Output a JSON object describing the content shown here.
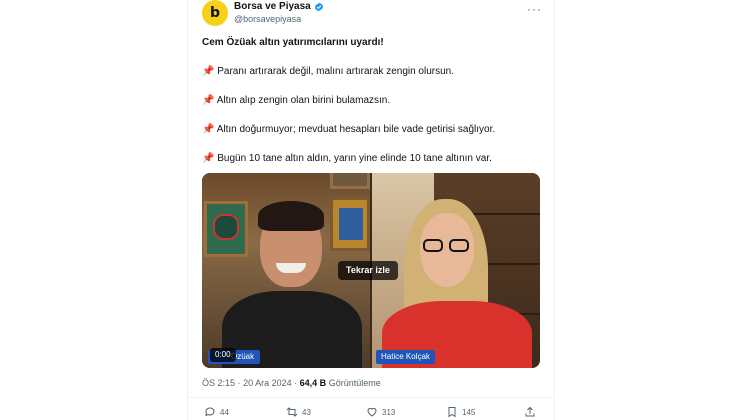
{
  "account": {
    "avatar_letter": "b",
    "display_name": "Borsa ve Piyasa",
    "handle": "@borsavepiyasa",
    "verified": true,
    "more_icon": "more-icon"
  },
  "post": {
    "headline": "Cem Özüak altın yatırımcılarını uyardı!",
    "pin_emoji": "📌",
    "lines": [
      "Paranı artırarak değil, malını artırarak zengin olursun.",
      "Altın alıp zengin olan birini bulamazsın.",
      "Altın doğurmuyor; mevduat hesapları bile vade getirisi sağlıyor.",
      "Bugün 10 tane altın aldın, yarın yine elinde 10 tane altının var."
    ]
  },
  "video": {
    "replay_label": "Tekrar izle",
    "time": "0:00",
    "left_name_tag": "Özüak",
    "right_name_tag": "Hatice Kolçak"
  },
  "meta": {
    "time": "ÖS 2:15",
    "dot": "·",
    "date": "20 Ara 2024",
    "views_count": "64,4 B",
    "views_label": "Görüntüleme"
  },
  "actions": {
    "replies": "44",
    "reposts": "43",
    "likes": "313",
    "bookmarks": "145"
  },
  "colors": {
    "accent": "#1d9bf0",
    "text": "#0f1419",
    "muted": "#536471",
    "avatar_bg": "#f7d117",
    "name_tag": "#1f55b8"
  }
}
